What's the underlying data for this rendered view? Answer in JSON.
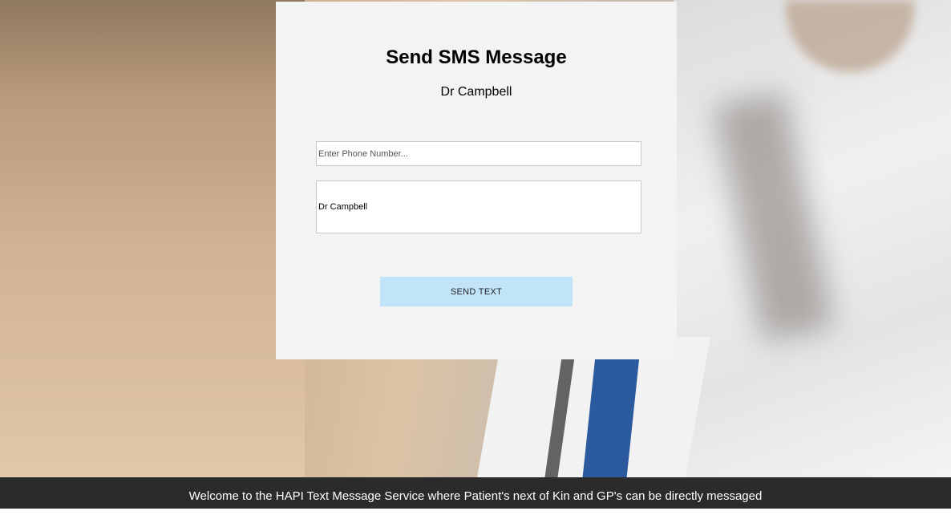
{
  "form": {
    "title": "Send SMS Message",
    "subtitle": "Dr Campbell",
    "phone_placeholder": "Enter Phone Number...",
    "phone_value": "",
    "message_value": "Dr Campbell",
    "send_label": "SEND TEXT",
    "send_button_color": "#c2e4f8"
  },
  "footer": {
    "text": "Welcome to the HAPI Text Message Service where Patient's next of Kin and GP's can be directly messaged"
  }
}
